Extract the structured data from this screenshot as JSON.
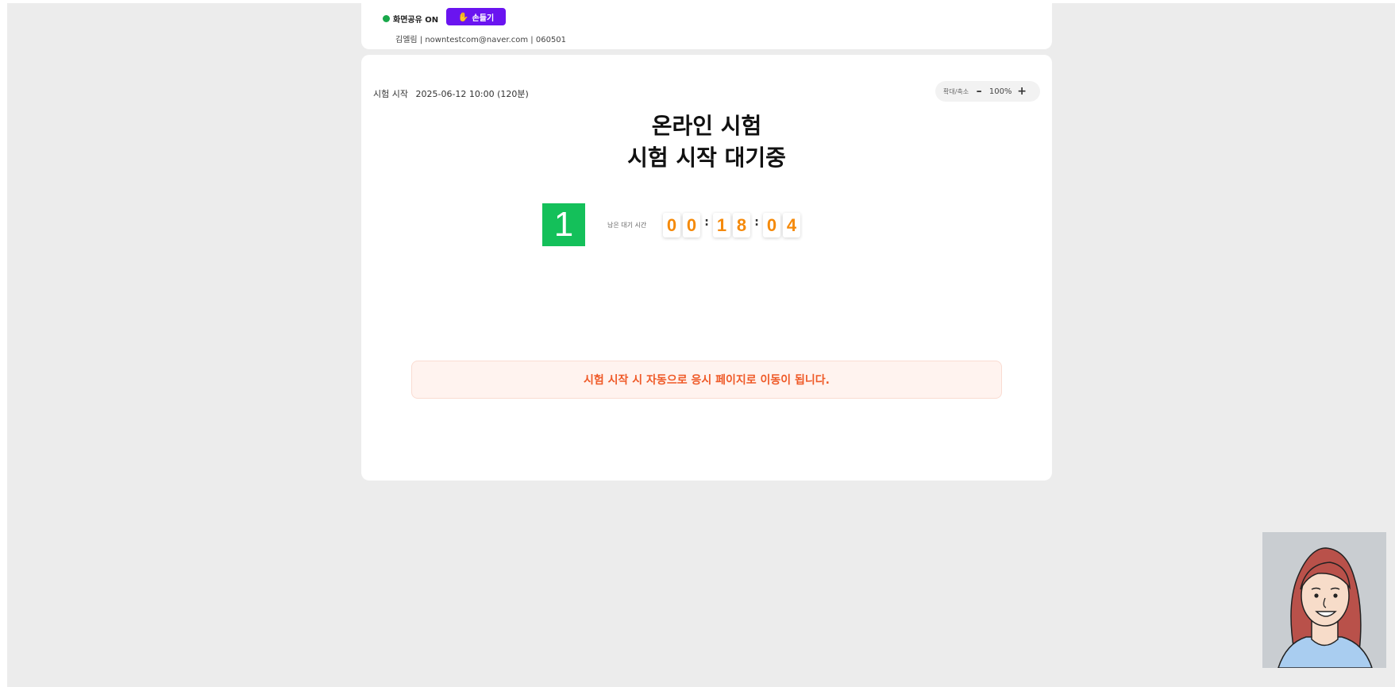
{
  "header": {
    "screen_share_label": "화면공유 ON",
    "raise_hand_label": "손들기",
    "user_info": "김엘림 | nowntestcom@naver.com | 060501"
  },
  "exam": {
    "start_label": "시험 시작",
    "start_value": "2025-06-12 10:00 (120분)",
    "title_line1": "온라인 시험",
    "title_line2": "시험 시작 대기중",
    "count": "1",
    "remaining_label": "남은 대기 시간",
    "timer": [
      "0",
      "0",
      "1",
      "8",
      "0",
      "4"
    ],
    "notice": "시험 시작 시 자동으로 응시 페이지로 이동이 됩니다."
  },
  "zoom": {
    "label": "확대/축소",
    "minus": "–",
    "value": "100%",
    "plus": "+"
  },
  "colors": {
    "accent_purple": "#6a14f0",
    "status_green": "#19a84a",
    "count_green": "#14c05a",
    "timer_orange": "#f58a0b",
    "notice_red": "#ef5a28"
  }
}
